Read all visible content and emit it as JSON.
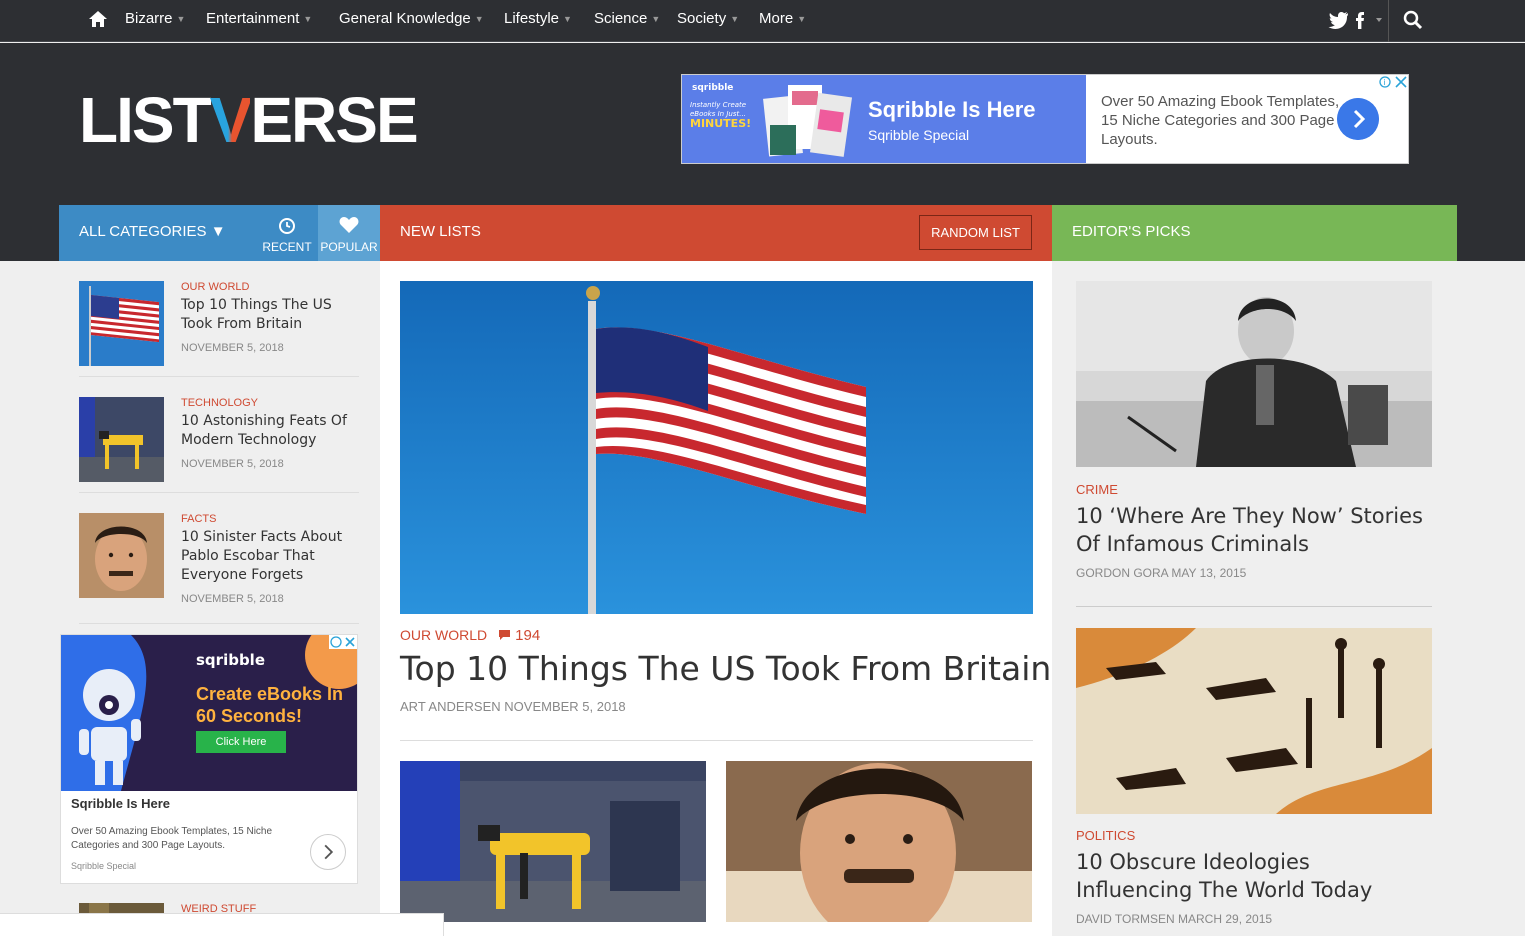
{
  "nav": {
    "items": [
      "Bizarre",
      "Entertainment",
      "General Knowledge",
      "Lifestyle",
      "Science",
      "Society",
      "More"
    ],
    "caret": "▼"
  },
  "logo": {
    "part1": "LIST",
    "v": "V",
    "part2": "ERSE"
  },
  "ad_top": {
    "brand": "sqribble",
    "tagline": "Instantly Create eBooks In Just...",
    "tagline_bold": "MINUTES!",
    "headline": "Sqribble Is Here",
    "sub": "Sqribble Special",
    "desc": "Over 50 Amazing Ebook Templates, 15 Niche Categories and 300 Page Layouts."
  },
  "bars": {
    "all_categories": "ALL CATEGORIES ▼",
    "recent": "RECENT",
    "popular": "POPULAR",
    "new_lists": "NEW LISTS",
    "random": "RANDOM LIST",
    "editors_picks": "EDITOR'S PICKS"
  },
  "sidebar": [
    {
      "category": "OUR WORLD",
      "title": "Top 10 Things The US Took From Britain",
      "date": "NOVEMBER 5, 2018"
    },
    {
      "category": "TECHNOLOGY",
      "title": "10 Astonishing Feats Of Modern Technology",
      "date": "NOVEMBER 5, 2018"
    },
    {
      "category": "FACTS",
      "title": "10 Sinister Facts About Pablo Escobar That Everyone Forgets",
      "date": "NOVEMBER 5, 2018"
    },
    {
      "category": "WEIRD STUFF"
    }
  ],
  "ad_side": {
    "brand": "sqribble",
    "headline": "Create eBooks In 60 Seconds!",
    "button": "Click Here",
    "title": "Sqribble Is Here",
    "desc": "Over 50 Amazing Ebook Templates, 15 Niche Categories and 300 Page Layouts.",
    "footer": "Sqribble Special"
  },
  "hero": {
    "category": "OUR WORLD",
    "comments": "194",
    "title": "Top 10 Things The US Took From Britain",
    "meta": "ART ANDERSEN NOVEMBER 5, 2018"
  },
  "picks": [
    {
      "category": "CRIME",
      "title": "10 ‘Where Are They Now’ Stories Of Infamous Criminals",
      "meta": "GORDON GORA MAY 13, 2015"
    },
    {
      "category": "POLITICS",
      "title": "10 Obscure Ideologies Influencing The World Today",
      "meta": "DAVID TORMSEN MARCH 29, 2015"
    }
  ],
  "colors": {
    "header_bg": "#2d2f33",
    "categories_blue": "#3d8bc5",
    "new_lists_red": "#cf4a32",
    "editors_green": "#78b756",
    "category_text": "#cf4a32"
  }
}
